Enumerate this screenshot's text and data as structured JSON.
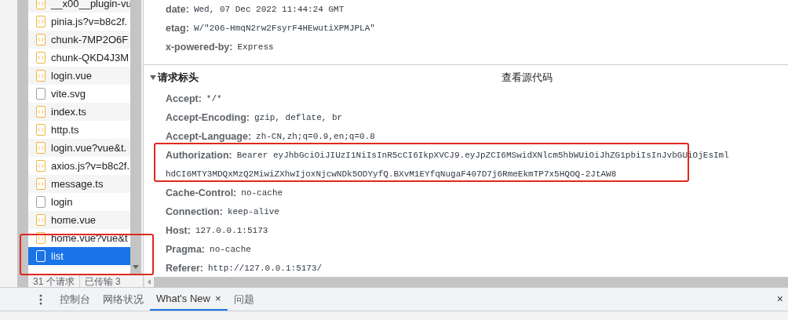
{
  "files": [
    {
      "name": "__x00__plugin-vu",
      "kind": "script",
      "selected": false
    },
    {
      "name": "pinia.js?v=b8c2f.",
      "kind": "script",
      "selected": false
    },
    {
      "name": "chunk-7MP2O6F",
      "kind": "script",
      "selected": false
    },
    {
      "name": "chunk-QKD4J3M",
      "kind": "script",
      "selected": false
    },
    {
      "name": "login.vue",
      "kind": "script",
      "selected": false
    },
    {
      "name": "vite.svg",
      "kind": "document",
      "selected": false
    },
    {
      "name": "index.ts",
      "kind": "script",
      "selected": false
    },
    {
      "name": "http.ts",
      "kind": "script",
      "selected": false
    },
    {
      "name": "login.vue?vue&t.",
      "kind": "script",
      "selected": false
    },
    {
      "name": "axios.js?v=b8c2f.",
      "kind": "script",
      "selected": false
    },
    {
      "name": "message.ts",
      "kind": "script",
      "selected": false
    },
    {
      "name": "login",
      "kind": "document",
      "selected": false
    },
    {
      "name": "home.vue",
      "kind": "script",
      "selected": false
    },
    {
      "name": "home.vue?vue&t",
      "kind": "script",
      "selected": false
    },
    {
      "name": "list",
      "kind": "document",
      "selected": true
    }
  ],
  "status_bar": [
    "31 个请求",
    "已传输 3"
  ],
  "response_headers": [
    {
      "name": "date:",
      "lines": [
        "Wed, 07 Dec 2022 11:44:24 GMT"
      ]
    },
    {
      "name": "etag:",
      "lines": [
        "W/\"206-HmqN2rw2FsyrF4HEwutiXPMJPLA\""
      ]
    },
    {
      "name": "x-powered-by:",
      "lines": [
        "Express"
      ]
    }
  ],
  "request_section": {
    "title": "请求标头",
    "expanded": true,
    "view_source": "查看源代码"
  },
  "request_headers": [
    {
      "name": "Accept:",
      "lines": [
        "*/*"
      ]
    },
    {
      "name": "Accept-Encoding:",
      "lines": [
        "gzip, deflate, br"
      ]
    },
    {
      "name": "Accept-Language:",
      "lines": [
        "zh-CN,zh;q=0.9,en;q=0.8"
      ]
    },
    {
      "name": "Authorization:",
      "lines": [
        "Bearer eyJhbGciOiJIUzI1NiIsInR5cCI6IkpXVCJ9.eyJpZCI6MSwidXNlcm5hbWUiOiJhZG1pbiIsInJvbGUiOjEsIml",
        "hdCI6MTY3MDQxMzQ2MiwiZXhwIjoxNjcwNDk5ODYyfQ.BXvM1EYfqNugaF407D7j6RmeEkmTP7x5HQOQ-2JtAW8"
      ]
    },
    {
      "name": "Cache-Control:",
      "lines": [
        "no-cache"
      ]
    },
    {
      "name": "Connection:",
      "lines": [
        "keep-alive"
      ]
    },
    {
      "name": "Host:",
      "lines": [
        "127.0.0.1:5173"
      ]
    },
    {
      "name": "Pragma:",
      "lines": [
        "no-cache"
      ]
    },
    {
      "name": "Referer:",
      "lines": [
        "http://127.0.0.1:5173/"
      ]
    }
  ],
  "drawer": {
    "close": "×",
    "tabs": [
      {
        "label": "控制台",
        "selected": false
      },
      {
        "label": "网络状况",
        "selected": false
      },
      {
        "label": "What's New",
        "selected": true,
        "close": "×"
      },
      {
        "label": "问题",
        "selected": false
      }
    ]
  }
}
